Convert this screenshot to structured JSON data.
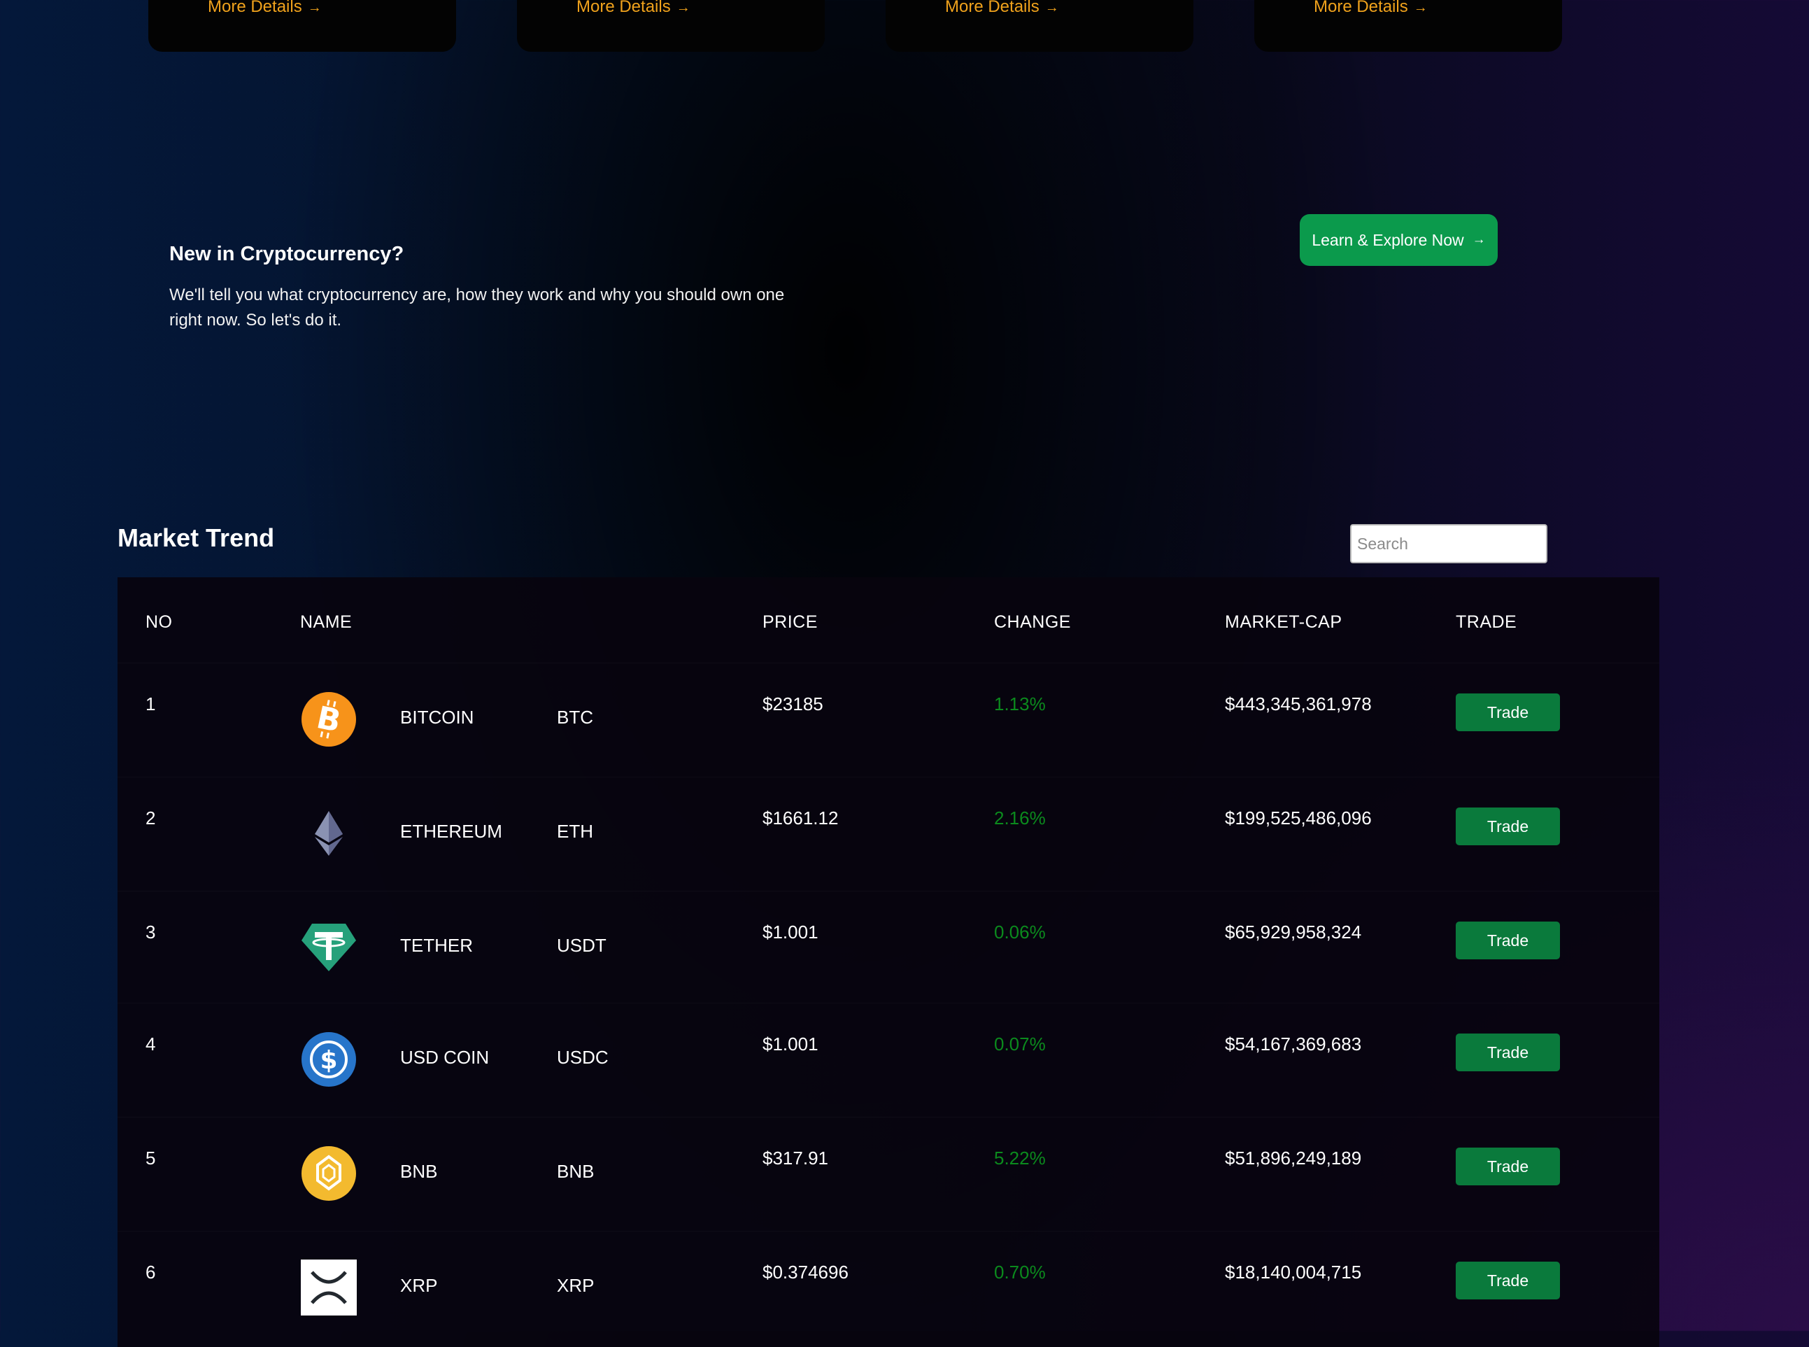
{
  "cards": [
    {
      "more_label": "More Details",
      "arrow": "→"
    },
    {
      "more_label": "More Details",
      "arrow": "→"
    },
    {
      "more_label": "More Details",
      "arrow": "→"
    },
    {
      "more_label": "More Details",
      "arrow": "→"
    }
  ],
  "intro": {
    "title": "New in Cryptocurrency?",
    "text": "We'll tell you what cryptocurrency are, how they work and why you should own one right now. So let's do it.",
    "button_label": "Learn & Explore Now",
    "button_arrow": "→"
  },
  "market": {
    "title": "Market Trend",
    "search_placeholder": "Search",
    "headers": {
      "no": "NO",
      "name": "NAME",
      "price": "PRICE",
      "change": "CHANGE",
      "market_cap": "MARKET-CAP",
      "trade": "TRADE"
    },
    "rows": [
      {
        "no": "1",
        "name": "BITCOIN",
        "symbol": "BTC",
        "price": "$23185",
        "change": "1.13%",
        "market_cap": "$443,345,361,978",
        "trade_label": "Trade",
        "icon": "bitcoin-icon"
      },
      {
        "no": "2",
        "name": "ETHEREUM",
        "symbol": "ETH",
        "price": "$1661.12",
        "change": "2.16%",
        "market_cap": "$199,525,486,096",
        "trade_label": "Trade",
        "icon": "ethereum-icon"
      },
      {
        "no": "3",
        "name": "TETHER",
        "symbol": "USDT",
        "price": "$1.001",
        "change": "0.06%",
        "market_cap": "$65,929,958,324",
        "trade_label": "Trade",
        "icon": "tether-icon"
      },
      {
        "no": "4",
        "name": "USD COIN",
        "symbol": "USDC",
        "price": "$1.001",
        "change": "0.07%",
        "market_cap": "$54,167,369,683",
        "trade_label": "Trade",
        "icon": "usd-coin-icon"
      },
      {
        "no": "5",
        "name": "BNB",
        "symbol": "BNB",
        "price": "$317.91",
        "change": "5.22%",
        "market_cap": "$51,896,249,189",
        "trade_label": "Trade",
        "icon": "bnb-icon"
      },
      {
        "no": "6",
        "name": "XRP",
        "symbol": "XRP",
        "price": "$0.374696",
        "change": "0.70%",
        "market_cap": "$18,140,004,715",
        "trade_label": "Trade",
        "icon": "xrp-icon"
      }
    ]
  },
  "colors": {
    "accent_orange": "#f0a21c",
    "button_green": "#0b9a4c",
    "trade_green": "#0a7a3c",
    "change_green": "#0b8a1d"
  }
}
